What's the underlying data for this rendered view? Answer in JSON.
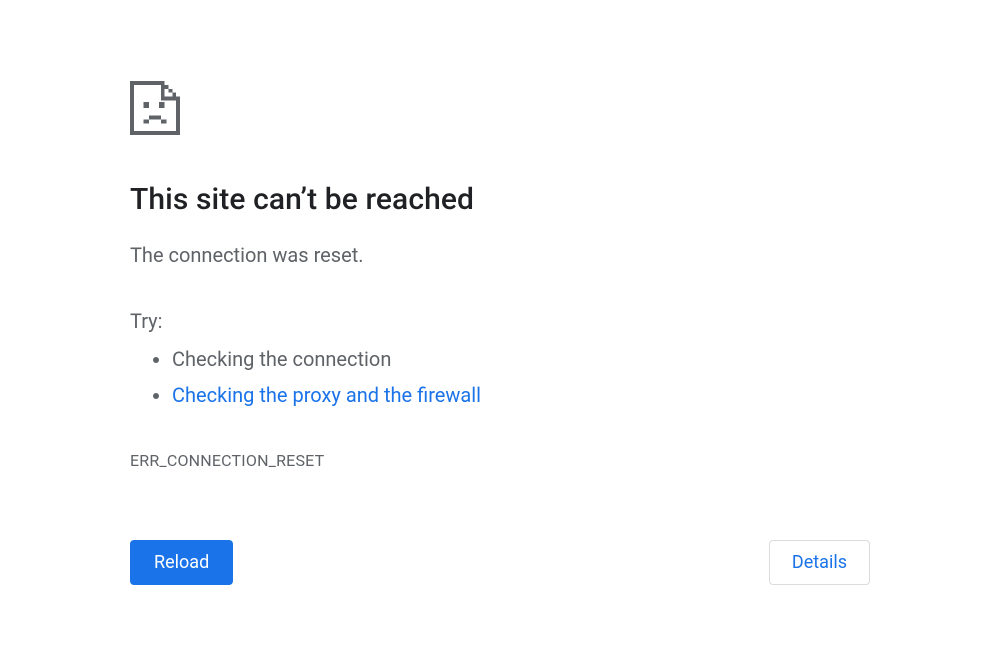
{
  "title": "This site can’t be reached",
  "message": "The connection was reset.",
  "try_label": "Try:",
  "suggestions": [
    {
      "text": "Checking the connection",
      "link": false
    },
    {
      "text": "Checking the proxy and the firewall",
      "link": true
    }
  ],
  "error_code": "ERR_CONNECTION_RESET",
  "buttons": {
    "reload": "Reload",
    "details": "Details"
  }
}
